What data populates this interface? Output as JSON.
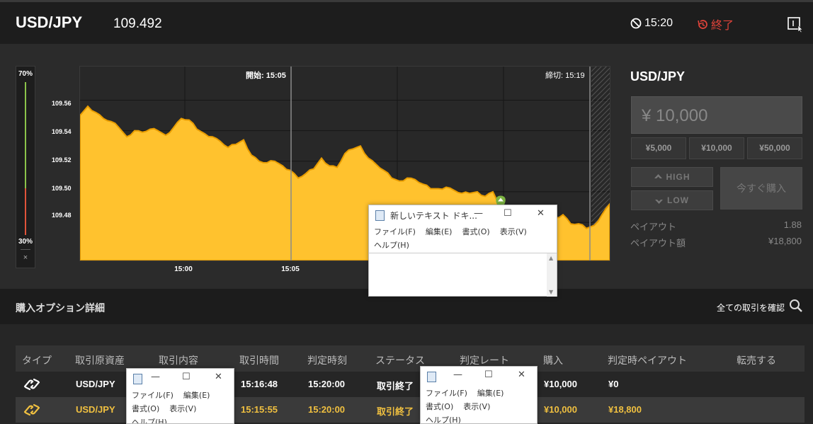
{
  "header": {
    "pair": "USD/JPY",
    "rate": "109.492",
    "timer": "15:20",
    "end_label": "終了"
  },
  "ratio": {
    "top_pct": "70%",
    "bottom_pct": "30%",
    "close": "×"
  },
  "chart": {
    "y_ticks": [
      "109.56",
      "109.54",
      "109.52",
      "109.50",
      "109.48"
    ],
    "x_ticks": [
      "15:00",
      "15:05"
    ],
    "start_label": "開始: 15:05",
    "close_label": "締切: 15:19"
  },
  "chart_data": {
    "type": "area",
    "ylim": [
      109.455,
      109.582
    ],
    "y_ticks": [
      109.56,
      109.54,
      109.52,
      109.5,
      109.48
    ],
    "x_ticks": [
      "15:00",
      "15:05"
    ],
    "values": [
      109.55,
      109.556,
      109.552,
      109.548,
      109.546,
      109.542,
      109.536,
      109.54,
      109.539,
      109.541,
      109.54,
      109.537,
      109.542,
      109.548,
      109.547,
      109.541,
      109.538,
      109.536,
      109.533,
      109.529,
      109.531,
      109.534,
      109.524,
      109.52,
      109.519,
      109.52,
      109.517,
      109.514,
      109.509,
      109.512,
      109.515,
      109.522,
      109.517,
      109.516,
      109.525,
      109.528,
      109.53,
      109.522,
      109.518,
      109.514,
      109.509,
      109.507,
      109.509,
      109.508,
      109.505,
      109.502,
      109.502,
      109.503,
      109.501,
      109.499,
      109.499,
      109.5,
      109.497,
      109.5,
      109.49,
      109.486,
      109.485,
      109.484,
      109.484,
      109.48,
      109.483,
      109.483,
      109.485,
      109.479,
      109.479,
      109.476,
      109.478,
      109.485,
      109.492
    ],
    "marker_index": 54
  },
  "panel": {
    "title": "USD/JPY",
    "amount": "¥ 10,000",
    "presets": [
      "¥5,000",
      "¥10,000",
      "¥50,000"
    ],
    "high": "HIGH",
    "low": "LOW",
    "buy_now": "今すぐ購入",
    "payout_label": "ペイアウト",
    "payout_value": "1.88",
    "payout_amount_label": "ペイアウト額",
    "payout_amount_value": "¥18,800"
  },
  "options": {
    "title": "購入オプション詳細",
    "view_all": "全ての取引を確認"
  },
  "table": {
    "headers": [
      "タイプ",
      "取引原資産",
      "取引内容",
      "取引時間",
      "判定時刻",
      "ステータス",
      "判定レート",
      "購入",
      "判定時ペイアウト",
      "転売する"
    ],
    "rows": [
      {
        "asset": "USD/JPY",
        "time": "15:16:48",
        "judge": "15:20:00",
        "status": "取引終了",
        "buy": "¥10,000",
        "payout": "¥0"
      },
      {
        "asset": "USD/JPY",
        "time": "15:15:55",
        "judge": "15:20:00",
        "status": "取引終了",
        "buy": "¥10,000",
        "payout": "¥18,800"
      }
    ]
  },
  "notepad": {
    "title": "新しいテキスト ドキ...",
    "menu_file": "ファイル(F)",
    "menu_edit": "編集(E)",
    "menu_format": "書式(O)",
    "menu_view": "表示(V)",
    "menu_help": "ヘルプ(H)",
    "min": "—",
    "max": "☐",
    "close": "✕"
  },
  "colors": {
    "area": "#ffc22e",
    "area_edge": "#e89c00",
    "red": "#e0433a",
    "green": "#8bc34a",
    "highlight": "#f0c040"
  }
}
